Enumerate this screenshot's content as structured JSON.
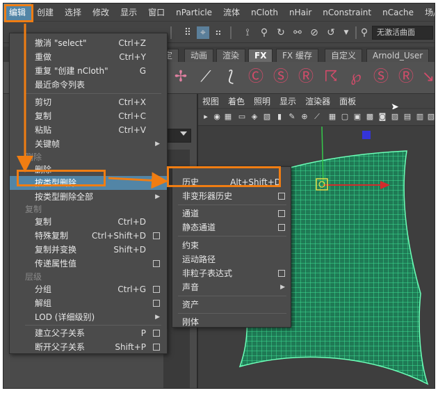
{
  "menubar": {
    "items": [
      "编辑",
      "创建",
      "选择",
      "修改",
      "显示",
      "窗口",
      "nParticle",
      "流体",
      "nCloth",
      "nHair",
      "nConstraint",
      "nCache",
      "场/解算"
    ]
  },
  "toolbar": {
    "deactivate_select": "无激活曲面"
  },
  "shelf_tabs": [
    "定",
    "动画",
    "渲染",
    "FX",
    "FX 缓存",
    "自定义",
    "Arnold_User"
  ],
  "viewport": {
    "menu": [
      "视图",
      "着色",
      "照明",
      "显示",
      "渲染器",
      "面板"
    ]
  },
  "edit_menu": {
    "undo": {
      "label": "撤消 \"select\"",
      "shortcut": "Ctrl+Z"
    },
    "redo": {
      "label": "重做",
      "shortcut": "Ctrl+Y"
    },
    "repeat": {
      "label": "重复 \"创建 nCloth\"",
      "shortcut": "G"
    },
    "recent_commands": "最近命令列表",
    "cut": {
      "label": "剪切",
      "shortcut": "Ctrl+X"
    },
    "copy": {
      "label": "复制",
      "shortcut": "Ctrl+C"
    },
    "paste": {
      "label": "粘贴",
      "shortcut": "Ctrl+V"
    },
    "keys": "关键帧",
    "section_delete": "删除",
    "delete": "删除",
    "delete_by_type": "按类型删除",
    "delete_all_by_type": "按类型删除全部",
    "section_duplicate": "复制",
    "duplicate": {
      "label": "复制",
      "shortcut": "Ctrl+D"
    },
    "duplicate_special": {
      "label": "特殊复制",
      "shortcut": "Ctrl+Shift+D"
    },
    "duplicate_with_transform": {
      "label": "复制并变换",
      "shortcut": "Shift+D"
    },
    "transfer_attr": "传递属性值",
    "section_hierarchy": "层级",
    "group": {
      "label": "分组",
      "shortcut": "Ctrl+G"
    },
    "ungroup": "解组",
    "lod": "LOD (详细级别)",
    "parent": {
      "label": "建立父子关系",
      "shortcut": "P"
    },
    "unparent": {
      "label": "断开父子关系",
      "shortcut": "Shift+P"
    }
  },
  "submenu": {
    "history": {
      "label": "历史",
      "shortcut": "Alt+Shift+D"
    },
    "non_deformer_history": "非变形器历史",
    "channels": "通道",
    "static_channels": "静态通道",
    "constraints": "约束",
    "motion_paths": "运动路径",
    "non_particle_expressions": "非粒子表达式",
    "sound": "声音",
    "assets": "资产",
    "rigid_bodies": "刚体"
  },
  "colors": {
    "accent_orange": "#f07d12",
    "highlight_blue": "#5285a6",
    "mesh_green": "#35e89a"
  }
}
